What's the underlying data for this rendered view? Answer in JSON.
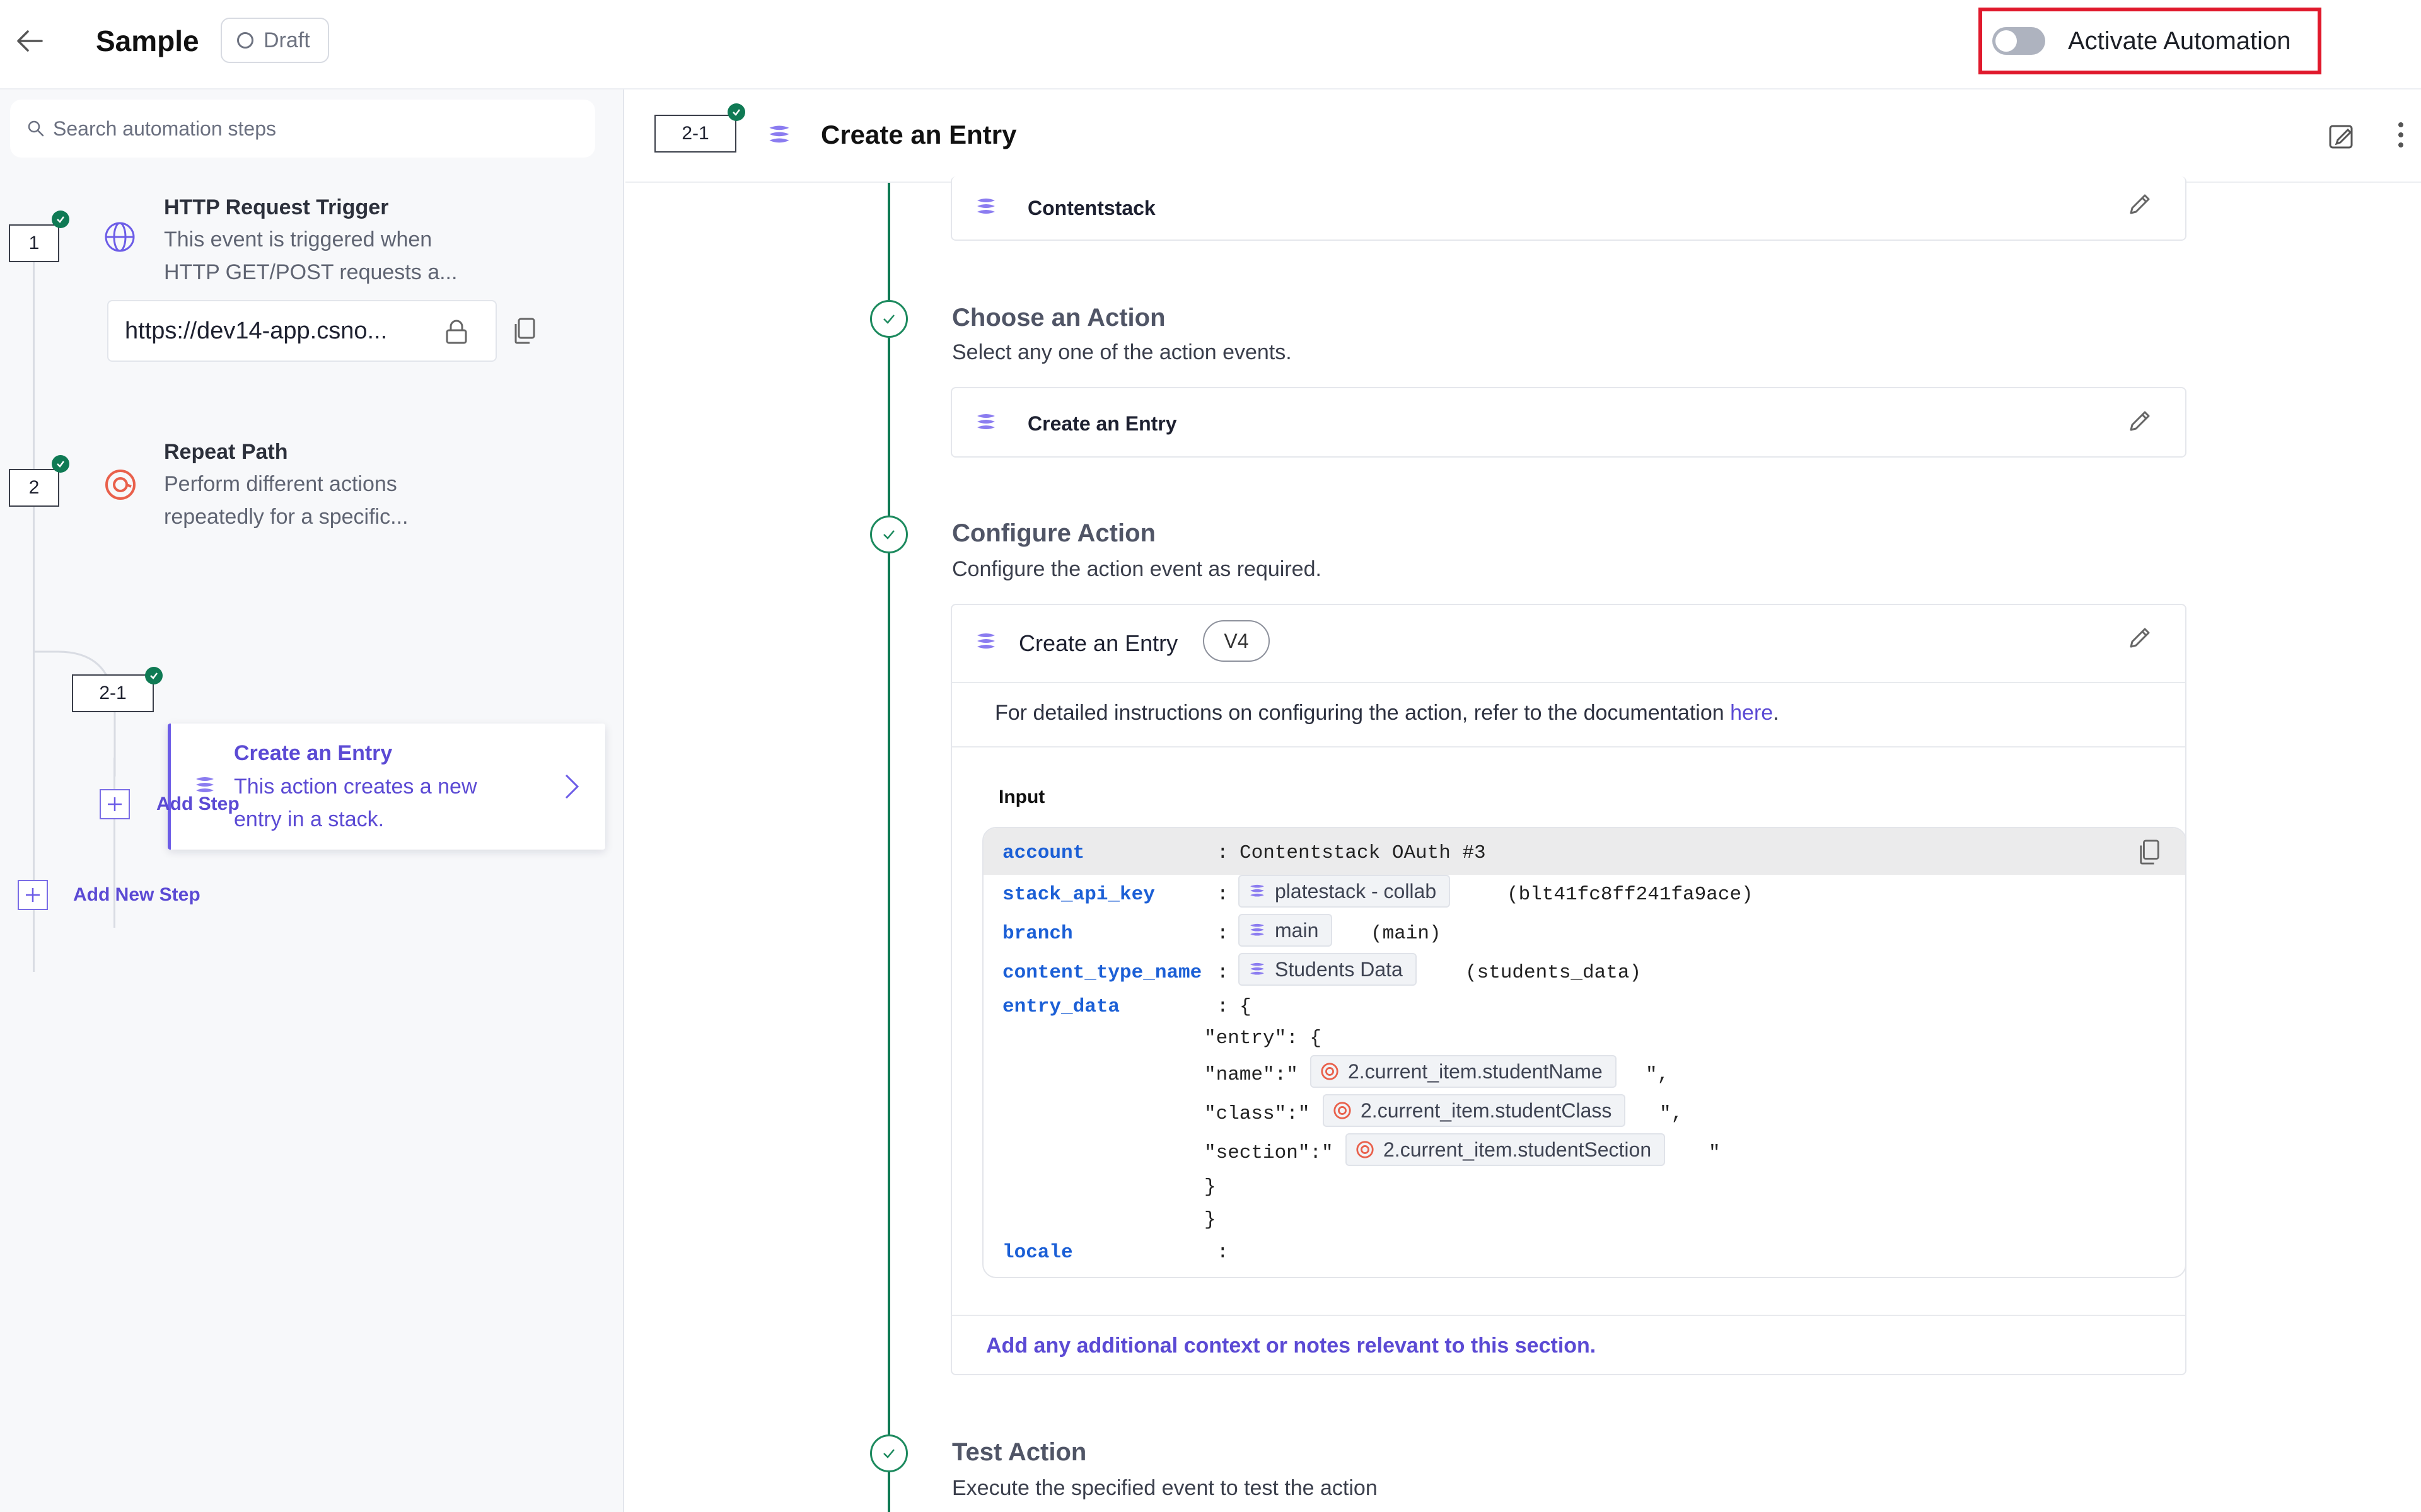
{
  "header": {
    "title": "Sample",
    "status": "Draft",
    "activate_label": "Activate Automation"
  },
  "sidebar": {
    "search_placeholder": "Search automation steps",
    "steps": [
      {
        "num": "1",
        "title": "HTTP Request Trigger",
        "desc_line1": "This event is triggered when",
        "desc_line2": "HTTP GET/POST requests a..."
      },
      {
        "num": "2",
        "title": "Repeat Path",
        "desc_line1": "Perform different actions",
        "desc_line2": "repeatedly for a specific..."
      }
    ],
    "url": "https://dev14-app.csno...",
    "substep": {
      "num": "2-1",
      "title": "Create an Entry",
      "desc": "This action creates a new entry in a stack."
    },
    "add_step": "Add Step",
    "add_new_step": "Add New Step"
  },
  "main": {
    "step_num": "2-1",
    "title": "Create an Entry",
    "app_row": "Contentstack",
    "choose": {
      "title": "Choose an Action",
      "desc": "Select any one of the action events.",
      "value": "Create an Entry"
    },
    "configure": {
      "title": "Configure Action",
      "desc": "Configure the action event as required.",
      "card_title": "Create an Entry",
      "version": "V4",
      "doc_text": "For detailed instructions on configuring the action, refer to the documentation ",
      "doc_link": "here",
      "doc_end": ".",
      "input_label": "Input",
      "notes": "Add any additional context or notes relevant to this section."
    },
    "input": {
      "account_key": "account",
      "account_val": "Contentstack OAuth #3",
      "stack_key": "stack_api_key",
      "stack_chip": "platestack - collab",
      "stack_val": "(blt41fc8ff241fa9ace)",
      "branch_key": "branch",
      "branch_chip": "main",
      "branch_val": "(main)",
      "ct_key": "content_type_name",
      "ct_chip": "Students Data",
      "ct_val": "(students_data)",
      "entry_key": "entry_data",
      "brace_open": "{",
      "entry_line": "\"entry\": {",
      "name_prefix": "\"name\":\"",
      "name_chip": "2.current_item.studentName",
      "name_suffix": "\",",
      "class_prefix": "\"class\":\"",
      "class_chip": "2.current_item.studentClass",
      "class_suffix": "\",",
      "section_prefix": "\"section\":\"",
      "section_chip": "2.current_item.studentSection",
      "section_suffix": "\"",
      "close1": "}",
      "close2": "}",
      "locale_key": "locale",
      "colon": ":"
    },
    "test": {
      "title": "Test Action",
      "desc": "Execute the specified event to test the action"
    }
  },
  "colors": {
    "accent": "#5b4ad4",
    "success": "#0f7a54",
    "highlight": "#e0192c",
    "code_key": "#1b5fd6"
  }
}
